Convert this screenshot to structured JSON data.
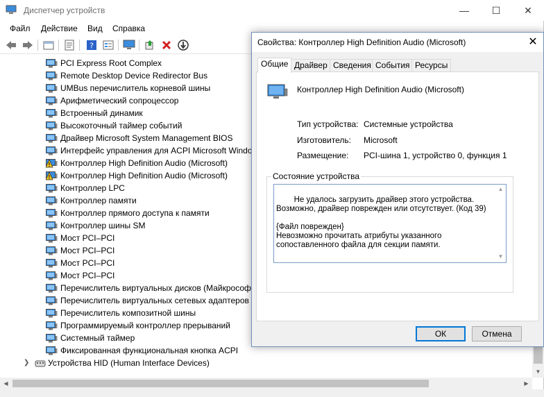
{
  "main": {
    "title": "Диспетчер устройств",
    "window_controls": {
      "minimize": "—",
      "maximize": "☐",
      "close": "✕"
    },
    "menu": [
      "Файл",
      "Действие",
      "Вид",
      "Справка"
    ],
    "devices": [
      {
        "label": "PCI Express Root Complex",
        "warning": false
      },
      {
        "label": "Remote Desktop Device Redirector Bus",
        "warning": false
      },
      {
        "label": "UMBus перечислитель корневой шины",
        "warning": false
      },
      {
        "label": "Арифметический сопроцессор",
        "warning": false
      },
      {
        "label": "Встроенный динамик",
        "warning": false
      },
      {
        "label": "Высокоточный таймер событий",
        "warning": false
      },
      {
        "label": "Драйвер Microsoft System Management BIOS",
        "warning": false
      },
      {
        "label": "Интерфейс управления для ACPI Microsoft Windows",
        "warning": false
      },
      {
        "label": "Контроллер High Definition Audio (Microsoft)",
        "warning": true
      },
      {
        "label": "Контроллер High Definition Audio (Microsoft)",
        "warning": true
      },
      {
        "label": "Контроллер LPC",
        "warning": false
      },
      {
        "label": "Контроллер памяти",
        "warning": false
      },
      {
        "label": "Контроллер прямого доступа к памяти",
        "warning": false
      },
      {
        "label": "Контроллер шины SM",
        "warning": false
      },
      {
        "label": "Мост PCI–PCI",
        "warning": false
      },
      {
        "label": "Мост PCI–PCI",
        "warning": false
      },
      {
        "label": "Мост PCI–PCI",
        "warning": false
      },
      {
        "label": "Мост PCI–PCI",
        "warning": false
      },
      {
        "label": "Перечислитель виртуальных дисков (Майкрософт)",
        "warning": false
      },
      {
        "label": "Перечислитель виртуальных сетевых адаптеров NDIS",
        "warning": false
      },
      {
        "label": "Перечислитель композитной шины",
        "warning": false
      },
      {
        "label": "Программируемый контроллер прерываний",
        "warning": false
      },
      {
        "label": "Системный таймер",
        "warning": false
      },
      {
        "label": "Фиксированная функциональная кнопка ACPI",
        "warning": false
      }
    ],
    "hid_category": "Устройства HID (Human Interface Devices)"
  },
  "dialog": {
    "title": "Свойства: Контроллер High Definition Audio (Microsoft)",
    "close": "✕",
    "tabs": [
      "Общие",
      "Драйвер",
      "Сведения",
      "События",
      "Ресурсы"
    ],
    "active_tab": "Общие",
    "device_name": "Контроллер High Definition Audio (Microsoft)",
    "properties": {
      "type_label": "Тип устройства:",
      "type_value": "Системные устройства",
      "maker_label": "Изготовитель:",
      "maker_value": "Microsoft",
      "location_label": "Размещение:",
      "location_value": "PCI-шина 1, устройство 0, функция 1"
    },
    "status_caption": "Состояние устройства",
    "status_text": "Не удалось загрузить драйвер этого устройства. Возможно, драйвер поврежден или отсутствует. (Код 39)\n\n{Файл поврежден}\nНевозможно прочитать атрибуты указанного сопоставленного файла для секции памяти.",
    "ok_label": "ОК",
    "cancel_label": "Отмена"
  },
  "colors": {
    "accent": "#0078d7",
    "warning": "#f3c623",
    "error_x": "#d32020"
  }
}
